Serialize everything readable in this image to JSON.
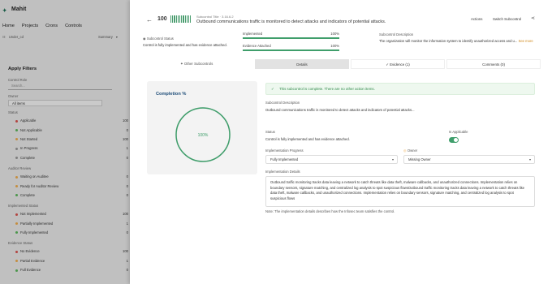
{
  "app": {
    "logo": "Mahit",
    "nav": [
      "Home",
      "Projects",
      "Crons",
      "Controls"
    ]
  },
  "toolbar": {
    "left": "Under_cd",
    "summary": "Summary"
  },
  "filters": {
    "title": "Apply Filters",
    "control_role_label": "Control Role",
    "search_placeholder": "Search...",
    "owner_label": "Owner",
    "owner_value": "All items",
    "status_label": "Status",
    "status_items": [
      {
        "label": "Applicable",
        "count": "100",
        "color": "#d9534f"
      },
      {
        "label": "Not Applicable",
        "count": "0",
        "color": "#5cb85c"
      },
      {
        "label": "Not Started",
        "count": "100",
        "color": "#f0ad4e"
      },
      {
        "label": "In Progress",
        "count": "1",
        "color": "#999999"
      },
      {
        "label": "Complete",
        "count": "0",
        "color": "#999999"
      }
    ],
    "auditor_label": "Auditor Review",
    "auditor_items": [
      {
        "label": "Waiting on Auditee",
        "count": "0",
        "color": "#f0ad4e"
      },
      {
        "label": "Ready for Auditor Review",
        "count": "0",
        "color": "#f0ad4e"
      },
      {
        "label": "Complete",
        "count": "0",
        "color": "#5cb85c"
      }
    ],
    "impl_label": "Implemented Status",
    "impl_items": [
      {
        "label": "Not Implemented",
        "count": "100",
        "color": "#d9534f"
      },
      {
        "label": "Partially Implemented",
        "count": "1",
        "color": "#f0ad4e"
      },
      {
        "label": "Fully Implemented",
        "count": "0",
        "color": "#5cb85c"
      }
    ],
    "evidence_label": "Evidence Status",
    "evidence_items": [
      {
        "label": "No Evidence",
        "count": "100",
        "color": "#d9534f"
      },
      {
        "label": "Partial Evidence",
        "count": "1",
        "color": "#f0ad4e"
      },
      {
        "label": "Full Evidence",
        "count": "0",
        "color": "#5cb85c"
      }
    ]
  },
  "header": {
    "score": "100",
    "subtitle_small": "Subcontrol Title · 3.16.6.2",
    "title": "Outbound communications traffic is monitored to detect attacks and indicators of potential attacks.",
    "actions": "Actions",
    "switch": "Switch Subcontrol"
  },
  "subcontrol_status": {
    "label": "Subcontrol Status",
    "text": "Control is fully implemented and has evidence attached."
  },
  "progress": {
    "implemented_label": "Implemented",
    "implemented_value": "100%",
    "implemented_fraction": 1.0,
    "evidence_label": "Evidence Attached",
    "evidence_value": "100%",
    "evidence_fraction": 1.0
  },
  "description": {
    "label": "Subcontrol Description",
    "text": "The organization will monitor the information system to identify unauthorized access and u...",
    "see_more": "See more"
  },
  "other_subcontrols": "Other Subcontrols",
  "tabs": [
    "Details",
    "Evidence (1)",
    "Comments (0)"
  ],
  "completion": {
    "title": "Completion %",
    "value": "100%",
    "fraction": 1.0
  },
  "banner": "This subcontrol is complete. There are no other action items.",
  "details": {
    "desc_label": "Subcontrol Description",
    "desc_text": "Outbound communications traffic is monitored to detect attacks and indicators of potential attacks...",
    "status_label": "Status",
    "status_text": "Control is fully implemented and has evidence attached.",
    "applicable_label": "Is Applicable",
    "impl_progress_label": "Implementation Progress",
    "impl_progress_value": "Fully Implemented",
    "owner_label": "Owner",
    "owner_value": "Missing Owner",
    "impl_details_label": "Implementation Details",
    "impl_details_text": "Outbound traffic monitoring tracks data leaving a network to catch threats like data theft, malware callbacks, and unauthorized connections. Implementation relies on boundary sensors, signature matching, and centralized log analysis to spot suspicious flowsOutbound traffic monitoring tracks data leaving a network to catch threats like data theft, malware callbacks, and unauthorized connections. Implementation relies on boundary sensors, signature matching, and centralized log analysis to spot suspicious flows",
    "note": "Note: The implementation details describes how the Infosec team satisfies the control."
  },
  "colors": {
    "accent": "#3f9e6b",
    "owner_warning": "#f0ad4e"
  }
}
